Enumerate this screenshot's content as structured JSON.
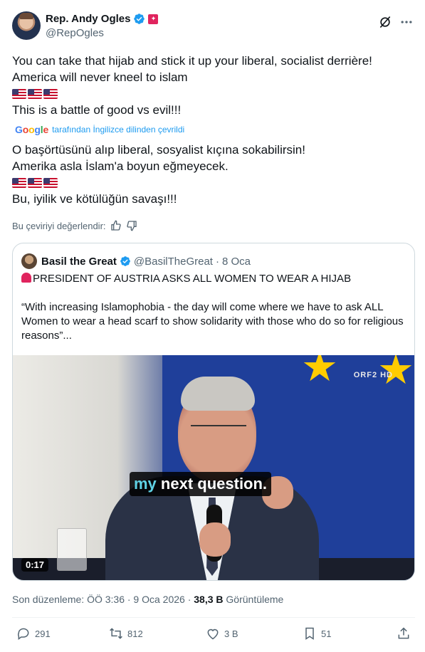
{
  "author": {
    "display_name": "Rep. Andy Ogles",
    "handle": "@RepOgles"
  },
  "tweet": {
    "lines": [
      "You can take that hijab and stick it up your liberal, socialist derrière!",
      "America will never kneel to islam",
      "This is a battle of good vs evil!!!"
    ],
    "flags": "🇺🇸🇺🇸🇺🇸"
  },
  "translation": {
    "google_letters": [
      "G",
      "o",
      "o",
      "g",
      "l",
      "e"
    ],
    "by_text": "tarafından İngilizce dilinden çevrildi",
    "lines": [
      "O başörtüsünü alıp liberal, sosyalist kıçına sokabilirsin!",
      "Amerika asla İslam'a boyun eğmeyecek.",
      "Bu, iyilik ve kötülüğün savaşı!!!"
    ],
    "rate_label": "Bu çeviriyi değerlendir:"
  },
  "quote": {
    "display_name": "Basil the Great",
    "handle": "@BasilTheGreat",
    "date": "8 Oca",
    "separator": "·",
    "headline": "PRESIDENT OF AUSTRIA ASKS ALL WOMEN TO WEAR A HIJAB",
    "body": "“With increasing Islamophobia - the day will come where we have to ask ALL Women to wear a head scarf to show solidarity with those who do so for religious reasons”...",
    "video": {
      "channel_logo": "ORF2 HD",
      "subtitle_word1": "my",
      "subtitle_rest": "next question.",
      "duration": "0:17"
    }
  },
  "meta": {
    "edited": "Son düzenleme: ÖÖ 3:36 · 9 Oca 2026 ·",
    "views_count": "38,3 B",
    "views_label": "Görüntüleme"
  },
  "actions": {
    "replies": "291",
    "reposts": "812",
    "likes": "3 B",
    "bookmarks": "51"
  },
  "colors": {
    "accent": "#1d9bf0",
    "muted": "#536471",
    "border": "#cfd9de"
  }
}
